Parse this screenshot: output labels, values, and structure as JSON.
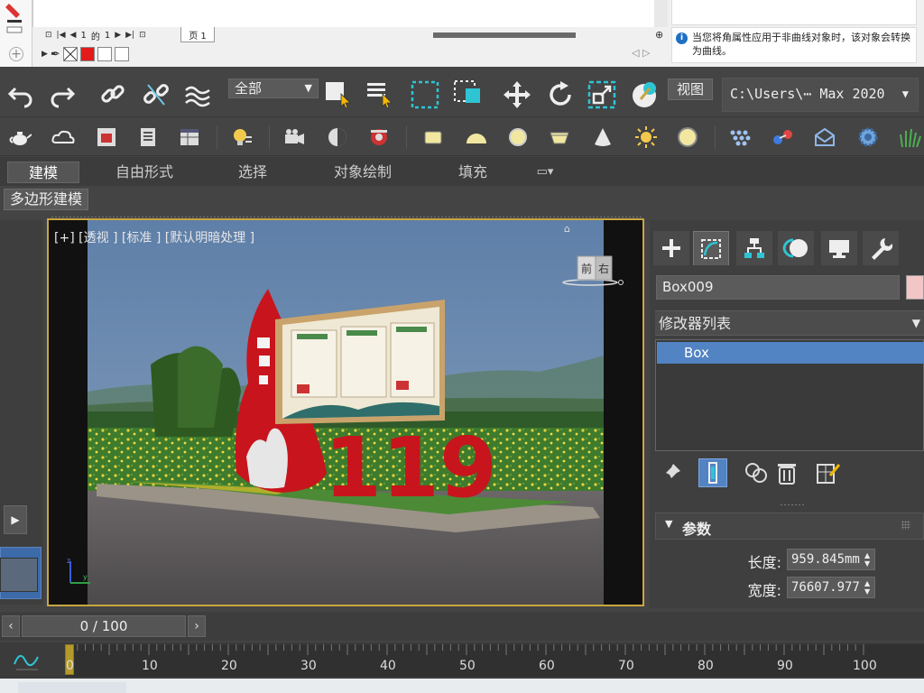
{
  "doc": {
    "page_current": "1",
    "page_of": "的",
    "page_total": "1",
    "page_tab": "页 1",
    "info_message": "当您将角属性应用于非曲线对象时，该对象会转换为曲线。"
  },
  "toolbar": {
    "selection_filter": "全部",
    "view_label": "视图",
    "project_path": "C:\\Users\\⋯ Max 2020"
  },
  "ribbon": {
    "tabs": [
      "建模",
      "自由形式",
      "选择",
      "对象绘制",
      "填充"
    ],
    "active_tab": 0,
    "sub_label": "多边形建模"
  },
  "viewport": {
    "label": "[+] [透视 ] [标准 ] [默认明暗处理 ]",
    "viewcube_front": "前",
    "viewcube_right": "右",
    "sign_text": "119"
  },
  "command_panel": {
    "object_name": "Box009",
    "object_color": "#f3c6c6",
    "modifier_list": "修改器列表",
    "stack_items": [
      "Box"
    ],
    "rollout_title": "参数",
    "params": [
      {
        "label": "长度:",
        "value": "959.845mm"
      },
      {
        "label": "宽度:",
        "value": "76607.977"
      }
    ]
  },
  "timeline": {
    "frame_display": "0 / 100",
    "ticks": [
      "0",
      "10",
      "20",
      "30",
      "40",
      "50",
      "60",
      "70",
      "80",
      "90",
      "100"
    ]
  },
  "colors": {
    "accent_blue": "#5283c3",
    "viewport_border": "#c9a640",
    "sign_red": "#c8141c"
  }
}
